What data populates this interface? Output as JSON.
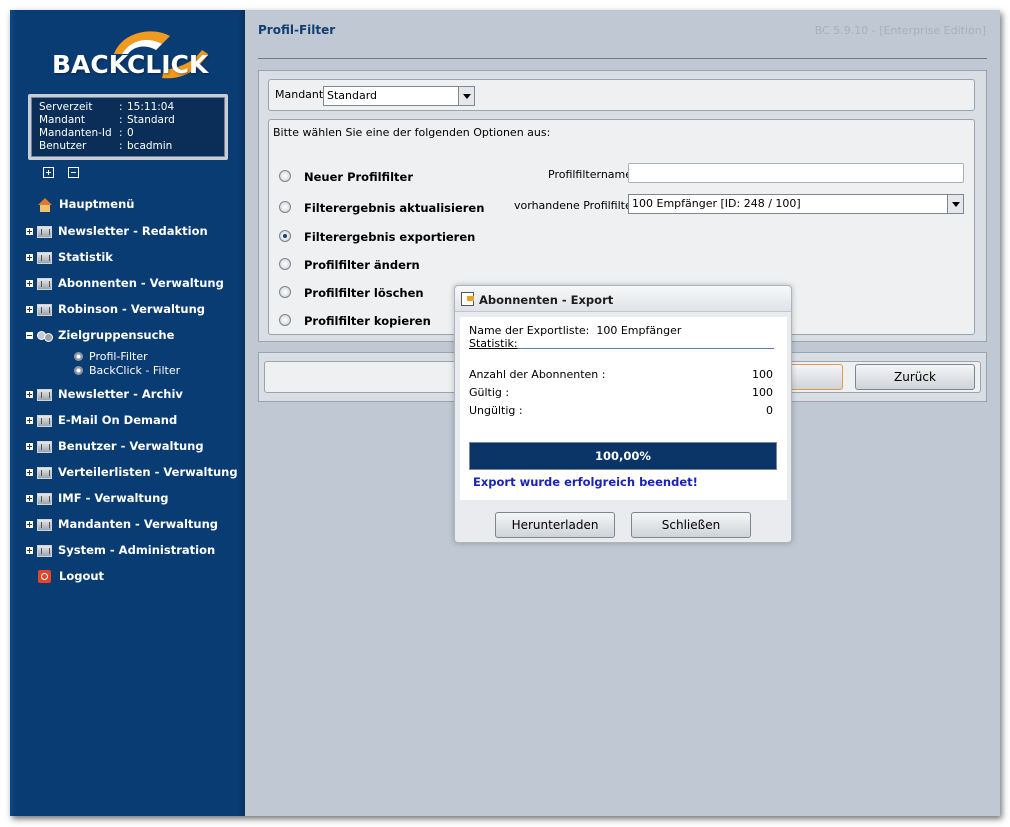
{
  "app": {
    "logo_text": "BACKCLICK",
    "page_title": "Profil-Filter",
    "version": "BC 5.9.10 - [Enterprise Edition]"
  },
  "info": {
    "rows": [
      {
        "key": "Serverzeit",
        "value": "15:11:04"
      },
      {
        "key": "Mandant",
        "value": "Standard"
      },
      {
        "key": "Mandanten-Id",
        "value": "0"
      },
      {
        "key": "Benutzer",
        "value": "bcadmin"
      }
    ],
    "separator": ":"
  },
  "nav": {
    "items": [
      {
        "label": "Hauptmenü",
        "icon": "home-icon"
      },
      {
        "label": "Newsletter - Redaktion",
        "icon": "folder-icon"
      },
      {
        "label": "Statistik",
        "icon": "folder-icon"
      },
      {
        "label": "Abonnenten - Verwaltung",
        "icon": "folder-icon"
      },
      {
        "label": "Robinson - Verwaltung",
        "icon": "folder-icon"
      },
      {
        "label": "Zielgruppensuche",
        "icon": "search-icon"
      },
      {
        "label": "Newsletter - Archiv",
        "icon": "folder-icon"
      },
      {
        "label": "E-Mail On Demand",
        "icon": "folder-icon"
      },
      {
        "label": "Benutzer - Verwaltung",
        "icon": "folder-icon"
      },
      {
        "label": "Verteilerlisten - Verwaltung",
        "icon": "folder-icon"
      },
      {
        "label": "IMF - Verwaltung",
        "icon": "folder-icon"
      },
      {
        "label": "Mandanten - Verwaltung",
        "icon": "folder-icon"
      },
      {
        "label": "System - Administration",
        "icon": "folder-icon"
      },
      {
        "label": "Logout",
        "icon": "logout-icon"
      }
    ],
    "subitems": [
      {
        "label": "Profil-Filter"
      },
      {
        "label": "BackClick - Filter"
      }
    ]
  },
  "form": {
    "mandant_label": "Mandant:",
    "mandant_value": "Standard",
    "prompt": "Bitte wählen Sie eine der folgenden Optionen aus:",
    "options": [
      {
        "label": "Neuer Profilfilter",
        "checked": false
      },
      {
        "label": "Filterergebnis aktualisieren",
        "checked": false
      },
      {
        "label": "Filterergebnis exportieren",
        "checked": true
      },
      {
        "label": "Profilfilter ändern",
        "checked": false
      },
      {
        "label": "Profilfilter löschen",
        "checked": false
      },
      {
        "label": "Profilfilter kopieren",
        "checked": false
      }
    ],
    "name_label": "Profilfiltername:",
    "name_value": "",
    "existing_label": "vorhandene Profilfilter:",
    "existing_value": "100 Empfänger [ID: 248 / 100]",
    "back_button": "Zurück"
  },
  "modal": {
    "title": "Abonnenten - Export",
    "export_list_label": "Name der Exportliste:",
    "export_list_value": "100 Empfänger",
    "statistik_label": "Statistik:",
    "stats": [
      {
        "label": "Anzahl der Abonnenten :",
        "value": "100"
      },
      {
        "label": "Gültig :",
        "value": "100"
      },
      {
        "label": "Ungültig :",
        "value": "0"
      }
    ],
    "progress_text": "100,00%",
    "progress_fraction": 1.0,
    "success_message": "Export wurde erfolgreich beendet!",
    "download_button": "Herunterladen",
    "close_button": "Schließen"
  },
  "colors": {
    "sidebar": "#0a3c74",
    "progress": "#0b3566",
    "success": "#1a22b8"
  }
}
